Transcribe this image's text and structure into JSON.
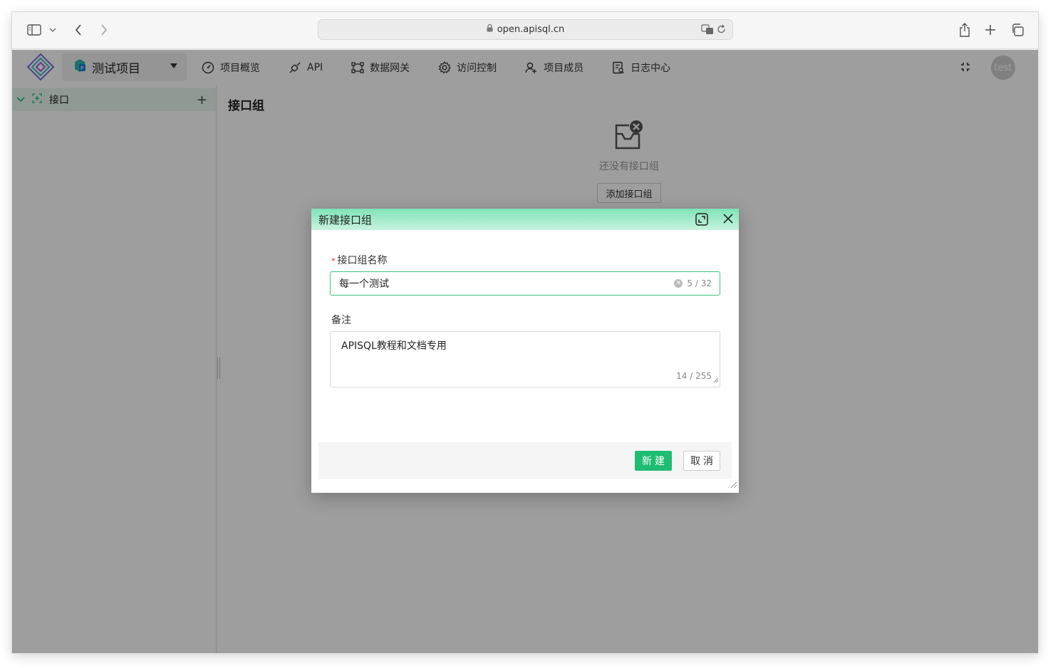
{
  "browser": {
    "url": "open.apisql.cn"
  },
  "header": {
    "project_name": "测试项目",
    "nav": [
      {
        "label": "项目概览",
        "icon": "dashboard-icon"
      },
      {
        "label": "API",
        "icon": "api-icon"
      },
      {
        "label": "数据网关",
        "icon": "gateway-icon"
      },
      {
        "label": "访问控制",
        "icon": "gear-icon"
      },
      {
        "label": "项目成员",
        "icon": "members-icon"
      },
      {
        "label": "日志中心",
        "icon": "log-icon"
      }
    ],
    "avatar_text": "test"
  },
  "sidebar": {
    "root_label": "接口"
  },
  "main": {
    "title": "接口组",
    "empty_text": "还没有接口组",
    "add_button": "添加接口组"
  },
  "dialog": {
    "title": "新建接口组",
    "name_label": "接口组名称",
    "name_value": "每一个测试",
    "name_counter": "5 / 32",
    "remark_label": "备注",
    "remark_value": "APISQL教程和文档专用",
    "remark_counter": "14 / 255",
    "submit_label": "新建",
    "cancel_label": "取消"
  },
  "colors": {
    "accent": "#1ebd72",
    "dialog_header": "#7fe3b7"
  }
}
